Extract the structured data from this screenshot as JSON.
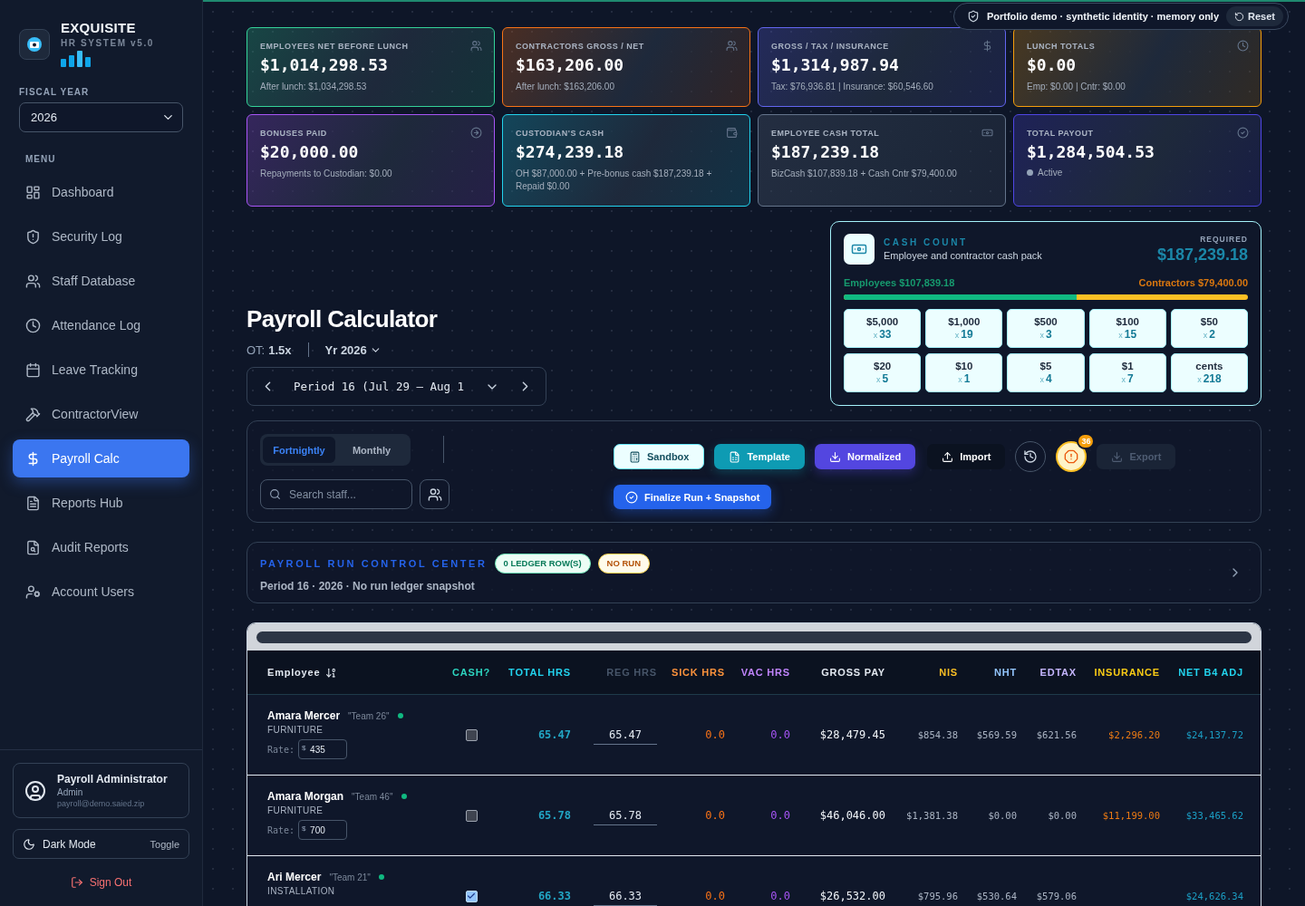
{
  "sidebar": {
    "brand": {
      "title": "EXQUISITE",
      "subtitle": "HR SYSTEM v5.0"
    },
    "fiscal_year": {
      "label": "FISCAL YEAR",
      "value": "2026"
    },
    "menu_label": "MENU",
    "items": [
      {
        "label": "Dashboard",
        "selected": false
      },
      {
        "label": "Security Log",
        "selected": false
      },
      {
        "label": "Staff Database",
        "selected": false
      },
      {
        "label": "Attendance Log",
        "selected": false
      },
      {
        "label": "Leave Tracking",
        "selected": false
      },
      {
        "label": "ContractorView",
        "selected": false
      },
      {
        "label": "Payroll Calc",
        "selected": true
      },
      {
        "label": "Reports Hub",
        "selected": false
      },
      {
        "label": "Audit Reports",
        "selected": false
      },
      {
        "label": "Account Users",
        "selected": false
      }
    ],
    "user": {
      "name": "Payroll Administrator",
      "role": "Admin",
      "email": "payroll@demo.saied.zip"
    },
    "theme": {
      "label": "Dark Mode",
      "action": "Toggle"
    },
    "sign_out": "Sign Out"
  },
  "banner": {
    "text": "Portfolio demo · synthetic identity · memory only",
    "action": "Reset"
  },
  "stats": [
    {
      "title": "EMPLOYEES NET BEFORE LUNCH",
      "value": "$1,014,298.53",
      "note": "After lunch: $1,034,298.53",
      "color": "#34d399"
    },
    {
      "title": "CONTRACTORS GROSS / NET",
      "value": "$163,206.00",
      "note": "After lunch: $163,206.00",
      "color": "#f97316"
    },
    {
      "title": "GROSS / TAX / INSURANCE",
      "value": "$1,314,987.94",
      "note": "Tax: $76,936.81 | Insurance: $60,546.60",
      "color": "#6366f1"
    },
    {
      "title": "LUNCH TOTALS",
      "value": "$0.00",
      "note": "Emp: $0.00 | Cntr: $0.00",
      "color": "#f59e0b"
    },
    {
      "title": "BONUSES PAID",
      "value": "$20,000.00",
      "note": "Repayments to Custodian: $0.00",
      "color": "#a855f7"
    },
    {
      "title": "CUSTODIAN'S CASH",
      "value": "$274,239.18",
      "note": "OH $87,000.00 + Pre-bonus cash $187,239.18 + Repaid $0.00",
      "color": "#22d3ee"
    },
    {
      "title": "EMPLOYEE CASH TOTAL",
      "value": "$187,239.18",
      "note": "BizCash $107,839.18 + Cash Cntr $79,400.00",
      "color": "#64748b"
    },
    {
      "title": "TOTAL PAYOUT",
      "value": "$1,284,504.53",
      "status": "Active",
      "color": "#4f46e5"
    }
  ],
  "header": {
    "title": "Payroll Calculator",
    "ot_label": "OT:",
    "ot_value": "1.5x",
    "year": "Yr 2026",
    "period": "Period 16 (Jul 29 – Aug 1"
  },
  "cash_count": {
    "title": "CASH COUNT",
    "subtitle": "Employee and contractor cash pack",
    "required_label": "REQUIRED",
    "required": "$187,239.18",
    "employees": "Employees $107,839.18",
    "contractors": "Contractors $79,400.00",
    "level": 0.576,
    "denominations": [
      {
        "label": "$5,000",
        "times": "x",
        "count": "33"
      },
      {
        "label": "$1,000",
        "times": "x",
        "count": "19"
      },
      {
        "label": "$500",
        "times": "x",
        "count": "3"
      },
      {
        "label": "$100",
        "times": "x",
        "count": "15"
      },
      {
        "label": "$50",
        "times": "x",
        "count": "2"
      },
      {
        "label": "$20",
        "times": "x",
        "count": "5"
      },
      {
        "label": "$10",
        "times": "x",
        "count": "1"
      },
      {
        "label": "$5",
        "times": "x",
        "count": "4"
      },
      {
        "label": "$1",
        "times": "x",
        "count": "7"
      },
      {
        "label": "cents",
        "times": "x",
        "count": "218"
      }
    ]
  },
  "toolbar": {
    "frequency": [
      {
        "label": "Fortnightly",
        "selected": true
      },
      {
        "label": "Monthly",
        "selected": false
      }
    ],
    "search_placeholder": "Search staff...",
    "actions": [
      {
        "kind": "sandbox",
        "label": "Sandbox",
        "disabled": false
      },
      {
        "kind": "template",
        "label": "Template",
        "disabled": false
      },
      {
        "kind": "normalized",
        "label": "Normalized",
        "disabled": false
      },
      {
        "kind": "import",
        "label": "Import",
        "disabled": false
      },
      {
        "kind": "history",
        "disabled": false
      },
      {
        "kind": "alerts",
        "badge": "36",
        "disabled": false
      },
      {
        "kind": "export",
        "label": "Export",
        "disabled": true
      }
    ],
    "finalize": "Finalize Run + Snapshot"
  },
  "control_center": {
    "title": "PAYROLL RUN CONTROL CENTER",
    "badges": [
      {
        "kind": "ledger",
        "label": "0 LEDGER ROW(S)"
      },
      {
        "kind": "run",
        "label": "NO RUN"
      }
    ],
    "subtitle": "Period 16 · 2026 · No run ledger snapshot"
  },
  "table": {
    "columns": [
      {
        "label": "Employee",
        "color": "#e2e8f0"
      },
      {
        "label": "CASH?",
        "color": "#2dd4bf"
      },
      {
        "label": "TOTAL HRS",
        "color": "#22d3ee"
      },
      {
        "label": "REG HRS",
        "color": "#475569"
      },
      {
        "label": "SICK HRS",
        "color": "#fb923c"
      },
      {
        "label": "VAC HRS",
        "color": "#c084fc"
      },
      {
        "label": "GROSS PAY",
        "color": "#e2e8f0"
      },
      {
        "label": "NIS",
        "color": "#fbbf24"
      },
      {
        "label": "NHT",
        "color": "#93c5fd"
      },
      {
        "label": "EDTAX",
        "color": "#c4b5fd"
      },
      {
        "label": "INSURANCE",
        "color": "#facc15"
      },
      {
        "label": "NET B4 ADJ",
        "color": "#22d3ee"
      }
    ],
    "rows": [
      {
        "name": "Amara Mercer",
        "team": "\"Team 26\"",
        "active": true,
        "department": "FURNITURE",
        "rate_label": "Rate:",
        "currency": "$",
        "rate": "435",
        "cash": false,
        "total_hrs": "65.47",
        "reg_hrs": "65.47",
        "sick_hrs": "0.0",
        "vac_hrs": "0.0",
        "gross": "$28,479.45",
        "nis": "$854.38",
        "nht": "$569.59",
        "edtax": "$621.56",
        "insurance": "$2,296.20",
        "net": "$24,137.72"
      },
      {
        "name": "Amara Morgan",
        "team": "\"Team 46\"",
        "active": true,
        "department": "FURNITURE",
        "rate_label": "Rate:",
        "currency": "$",
        "rate": "700",
        "cash": false,
        "total_hrs": "65.78",
        "reg_hrs": "65.78",
        "sick_hrs": "0.0",
        "vac_hrs": "0.0",
        "gross": "$46,046.00",
        "nis": "$1,381.38",
        "nht": "$0.00",
        "edtax": "$0.00",
        "insurance": "$11,199.00",
        "net": "$33,465.62"
      },
      {
        "name": "Ari Mercer",
        "team": "\"Team 21\"",
        "active": true,
        "department": "INSTALLATION",
        "cash": true,
        "total_hrs": "66.33",
        "reg_hrs": "66.33",
        "sick_hrs": "0.0",
        "vac_hrs": "0.0",
        "gross": "$26,532.00",
        "nis": "$795.96",
        "nht": "$530.64",
        "edtax": "$579.06",
        "net": "$24,626.34"
      }
    ]
  }
}
